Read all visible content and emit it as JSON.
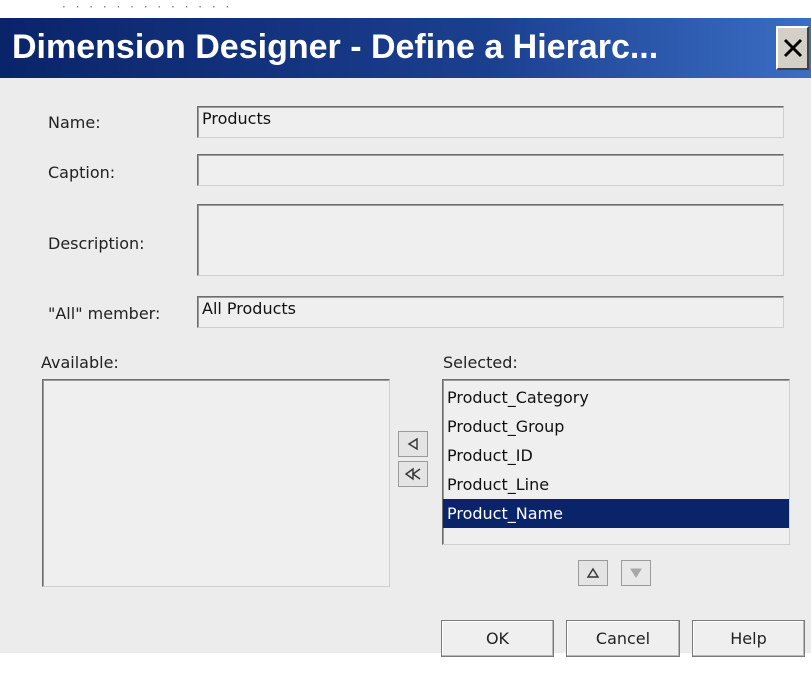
{
  "background_caption": "· · · · · · · · · · · · ·",
  "dialog": {
    "title": "Dimension Designer - Define a Hierarc...",
    "colors": {
      "titlebar": "#0a246a",
      "selection": "#0a246a",
      "body": "#ececec"
    }
  },
  "form": {
    "name_label": "Name:",
    "name_value": "Products",
    "caption_label": "Caption:",
    "caption_value": "",
    "description_label": "Description:",
    "description_value": "",
    "all_member_label": "\"All\" member:",
    "all_member_value": "All Products"
  },
  "available": {
    "label": "Available:",
    "items": []
  },
  "selected": {
    "label": "Selected:",
    "items": [
      "Product_Category",
      "Product_Group",
      "Product_ID",
      "Product_Line",
      "Product_Name"
    ],
    "selected_item": "Product_Name"
  },
  "icons": {
    "move_left": "arrow-left-icon",
    "move_all_left": "double-arrow-left-icon",
    "move_up": "arrow-up-icon",
    "move_down": "arrow-down-icon",
    "close": "close-icon"
  },
  "buttons": {
    "ok": "OK",
    "cancel": "Cancel",
    "help": "Help"
  }
}
